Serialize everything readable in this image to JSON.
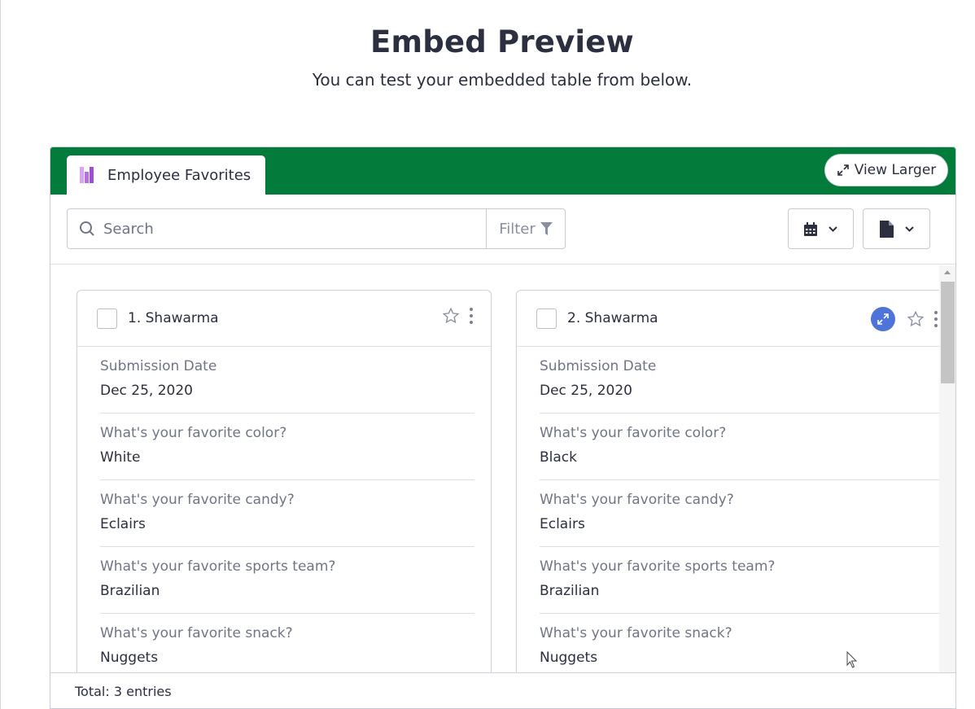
{
  "page": {
    "title": "Embed Preview",
    "subtitle": "You can test your embedded table from below."
  },
  "embed": {
    "header_color": "#027b3b",
    "tab_label": "Employee Favorites",
    "tab_icon": "table-bars-icon",
    "view_larger_label": "View Larger",
    "search": {
      "placeholder": "Search",
      "value": ""
    },
    "filter_label": "Filter",
    "toolbar_icons": [
      "calendar-icon",
      "file-icon"
    ],
    "footer_text": "Total: 3 entries"
  },
  "cards": [
    {
      "title": "1. Shawarma",
      "fields": [
        {
          "label": "Submission Date",
          "value": "Dec 25, 2020"
        },
        {
          "label": "What's your favorite color?",
          "value": "White"
        },
        {
          "label": "What's your favorite candy?",
          "value": "Eclairs"
        },
        {
          "label": "What's your favorite sports team?",
          "value": "Brazilian"
        },
        {
          "label": "What's your favorite snack?",
          "value": "Nuggets"
        }
      ]
    },
    {
      "title": "2. Shawarma",
      "fields": [
        {
          "label": "Submission Date",
          "value": "Dec 25, 2020"
        },
        {
          "label": "What's your favorite color?",
          "value": "Black"
        },
        {
          "label": "What's your favorite candy?",
          "value": "Eclairs"
        },
        {
          "label": "What's your favorite sports team?",
          "value": "Brazilian"
        },
        {
          "label": "What's your favorite snack?",
          "value": "Nuggets"
        }
      ]
    }
  ],
  "colors": {
    "expand_accent": "#4e73d9",
    "text": "#2b2f3f",
    "label": "#707586"
  }
}
